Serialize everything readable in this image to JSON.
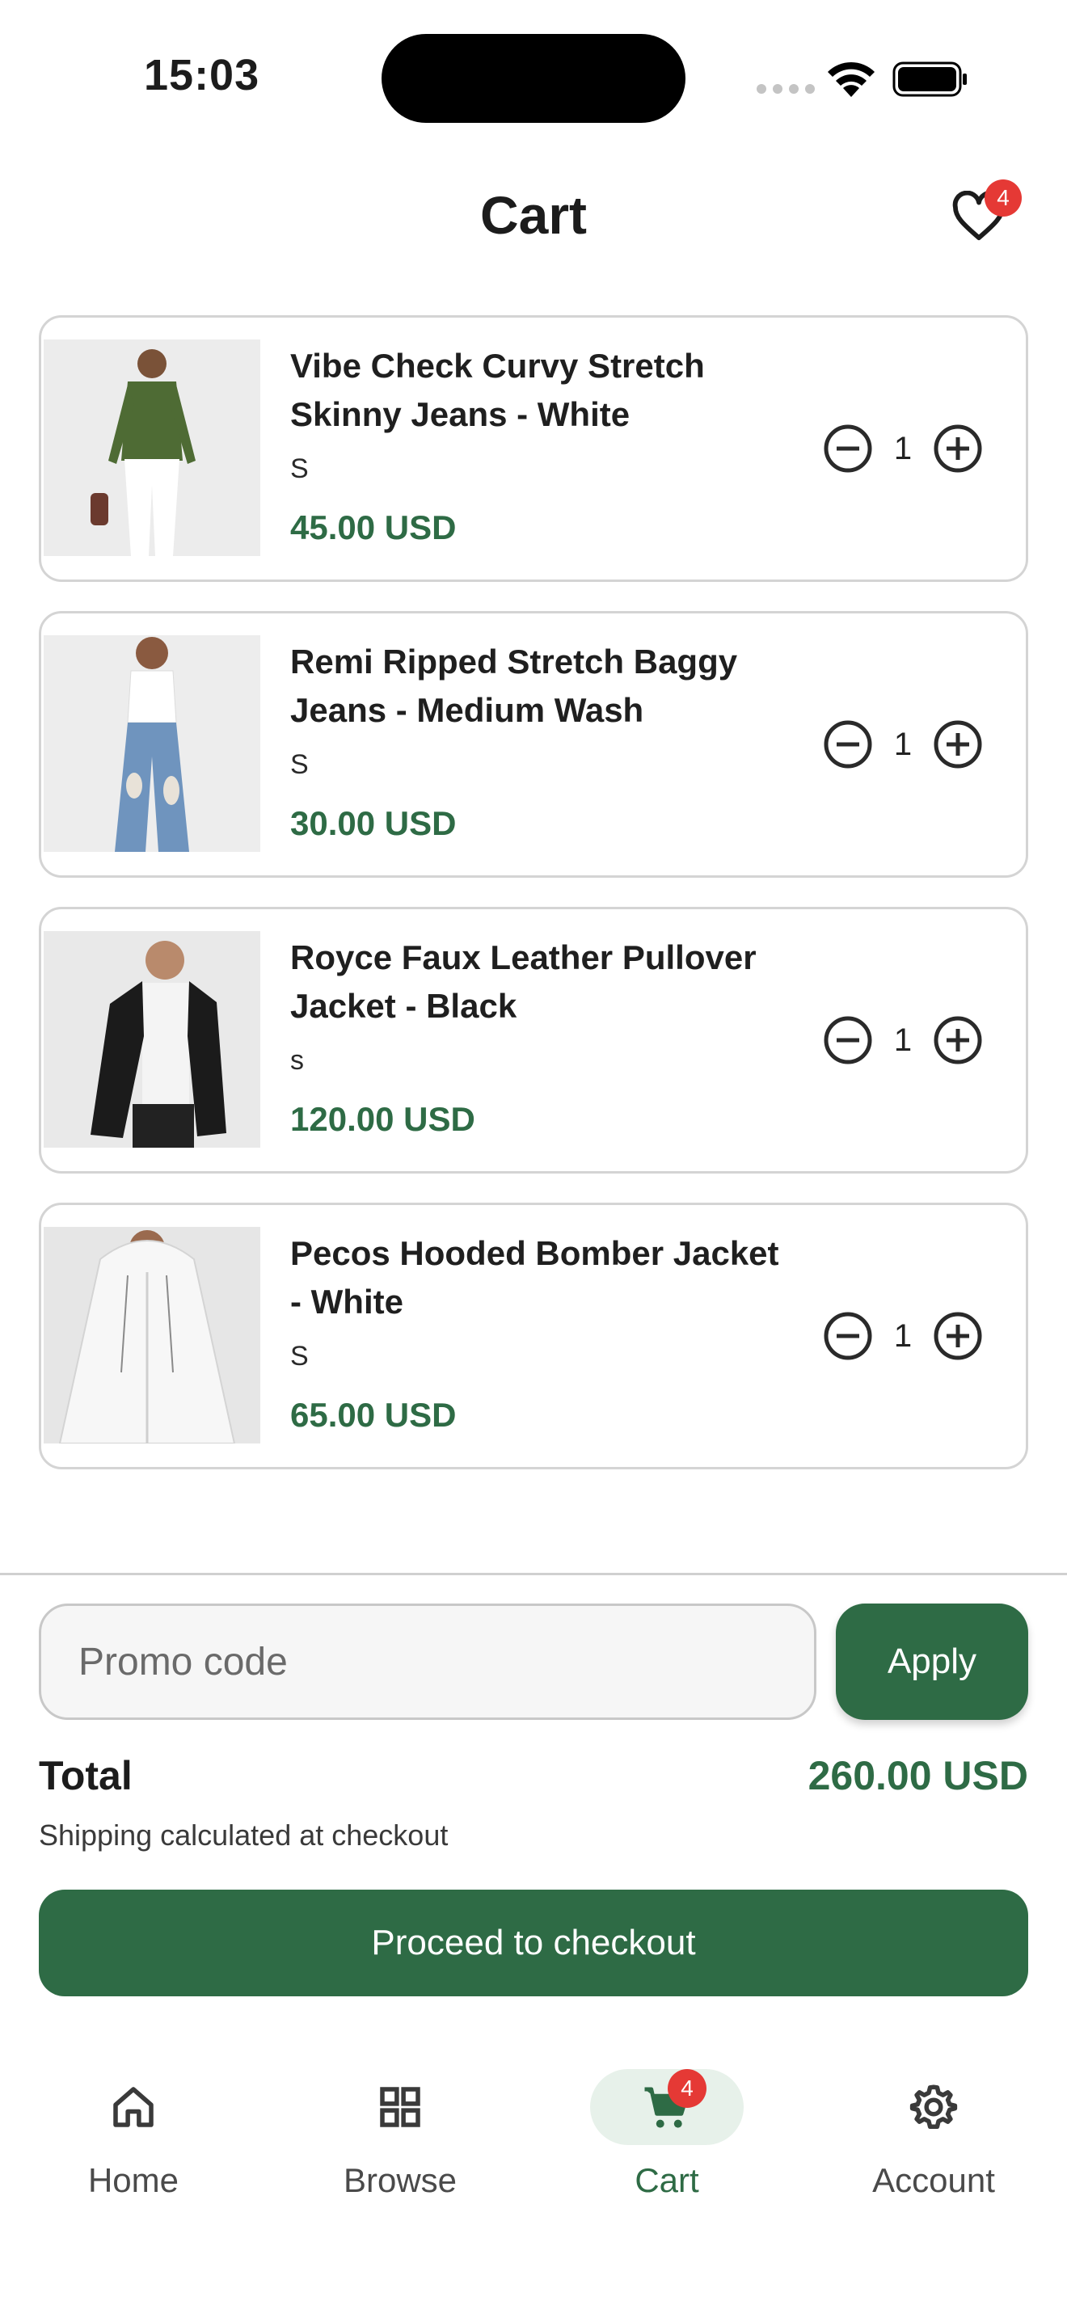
{
  "status": {
    "time": "15:03"
  },
  "header": {
    "title": "Cart",
    "wishlist_count": "4"
  },
  "items": [
    {
      "name": "Vibe Check Curvy Stretch Skinny Jeans - White",
      "size": "S",
      "price": "45.00 USD",
      "qty": "1"
    },
    {
      "name": "Remi Ripped Stretch Baggy Jeans - Medium Wash",
      "size": "S",
      "price": "30.00 USD",
      "qty": "1"
    },
    {
      "name": "Royce Faux Leather Pullover Jacket - Black",
      "size": "s",
      "price": "120.00 USD",
      "qty": "1"
    },
    {
      "name": "Pecos Hooded Bomber Jacket - White",
      "size": "S",
      "price": "65.00 USD",
      "qty": "1"
    }
  ],
  "promo": {
    "placeholder": "Promo code",
    "apply_label": "Apply"
  },
  "summary": {
    "total_label": "Total",
    "total_value": "260.00 USD",
    "shipping_note": "Shipping calculated at checkout"
  },
  "checkout": {
    "label": "Proceed to checkout"
  },
  "tabs": [
    {
      "label": "Home",
      "icon": "home-icon"
    },
    {
      "label": "Browse",
      "icon": "grid-icon"
    },
    {
      "label": "Cart",
      "icon": "cart-icon",
      "badge": "4",
      "active": true
    },
    {
      "label": "Account",
      "icon": "gear-icon"
    }
  ],
  "colors": {
    "accent": "#2e6b45",
    "badge": "#e53935",
    "border": "#d4d4d4"
  }
}
